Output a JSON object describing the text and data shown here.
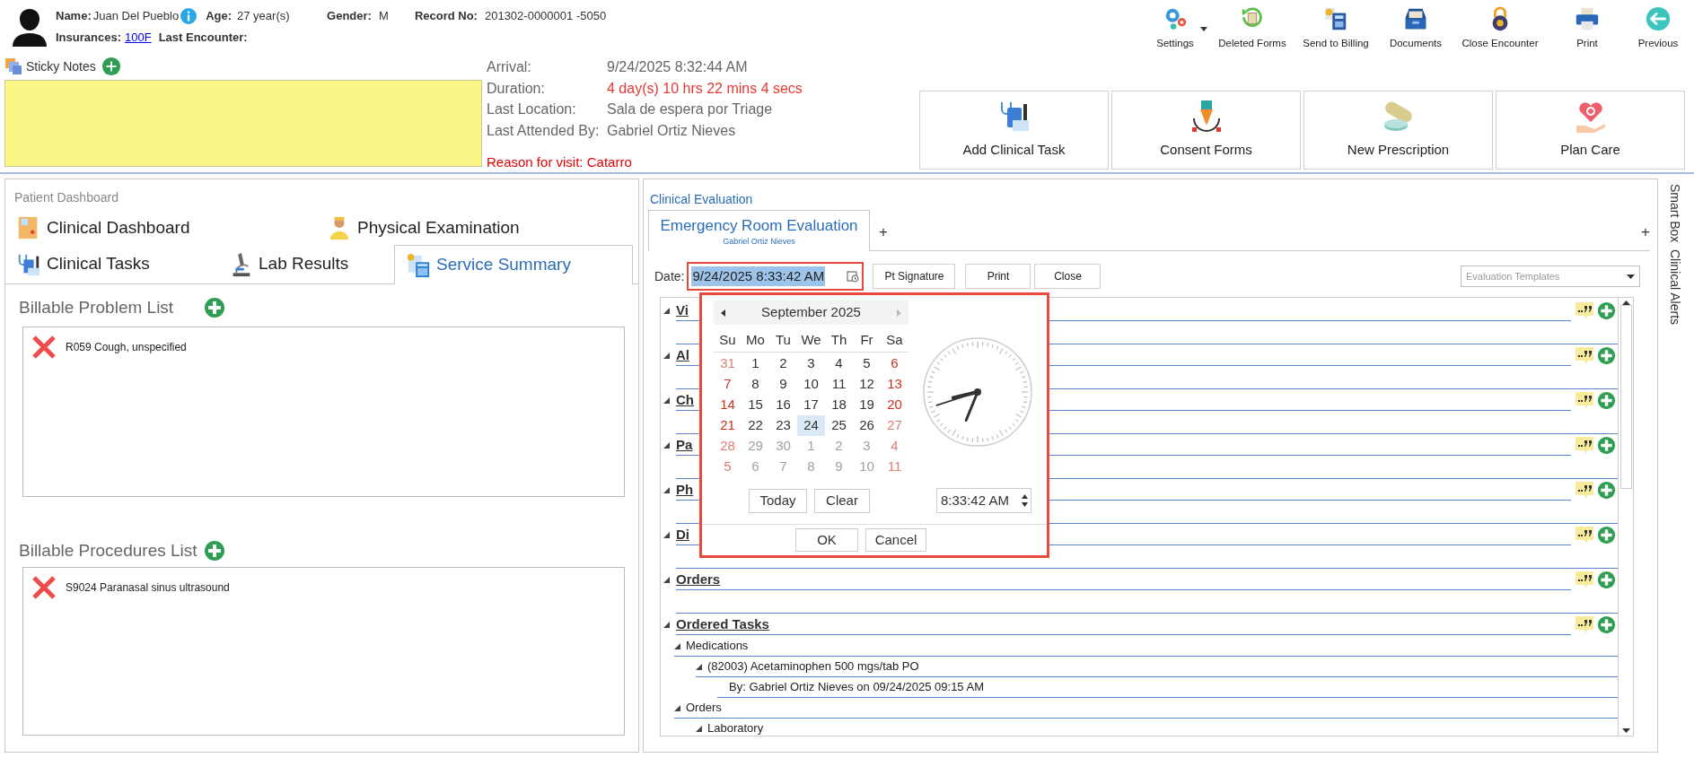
{
  "patient": {
    "name_label": "Name:",
    "name": "Juan Del Pueblo",
    "age_label": "Age:",
    "age": "27 year(s)",
    "gender_label": "Gender:",
    "gender": "M",
    "record_label": "Record No:",
    "record": "201302-0000001 -5050",
    "insurances_label": "Insurances:",
    "insurance": "100F",
    "last_encounter_label": "Last Encounter:"
  },
  "toolbar": [
    {
      "label": "Settings",
      "has_menu": true
    },
    {
      "label": "Deleted Forms",
      "has_menu": false
    },
    {
      "label": "Send to Billing",
      "has_menu": false
    },
    {
      "label": "Documents",
      "has_menu": false
    },
    {
      "label": "Close Encounter",
      "has_menu": false
    },
    {
      "label": "Print",
      "has_menu": false
    },
    {
      "label": "Previous",
      "has_menu": false
    }
  ],
  "sticky_notes": {
    "label": "Sticky Notes"
  },
  "visit": [
    {
      "label": "Arrival:",
      "value": "9/24/2025 8:32:44 AM",
      "alert": false
    },
    {
      "label": "Duration:",
      "value": "4 day(s) 10 hrs 22 mins 4 secs",
      "alert": true
    },
    {
      "label": "Last Location:",
      "value": "Sala de espera por Triage",
      "alert": false
    },
    {
      "label": "Last Attended By:",
      "value": "Gabriel Ortiz Nieves",
      "alert": false
    }
  ],
  "reason": "Reason for visit: Catarro",
  "actions": [
    "Add Clinical Task",
    "Consent Forms",
    "New Prescription",
    "Plan Care"
  ],
  "dashboard": {
    "title": "Patient Dashboard",
    "tab_rows": [
      [
        {
          "label": "Clinical Dashboard",
          "selected": false
        },
        {
          "label": "Physical Examination",
          "selected": false
        }
      ],
      [
        {
          "label": "Clinical Tasks",
          "selected": false
        },
        {
          "label": "Lab Results",
          "selected": false
        },
        {
          "label": "Service Summary",
          "selected": true
        }
      ]
    ],
    "lists": [
      {
        "title": "Billable Problem List",
        "items": [
          "R059 Cough, unspecified"
        ]
      },
      {
        "title": "Billable Procedures List",
        "items": [
          "S9024 Paranasal sinus ultrasound"
        ]
      }
    ]
  },
  "evaluation": {
    "title": "Clinical Evaluation",
    "tabs": [
      {
        "label": "Emergency Room Evaluation",
        "author": "Gabriel Ortiz Nieves",
        "selected": true
      }
    ],
    "add_tab": "+",
    "add_panel": "+",
    "date_label": "Date:",
    "date_value": "9/24/2025 8:33:42 AM",
    "buttons": [
      "Pt Signature",
      "Print",
      "Close"
    ],
    "templates": {
      "placeholder": "Evaluation Templates"
    },
    "sections": [
      {
        "label": "Vi",
        "expanded": true
      },
      {
        "label": "Al",
        "expanded": true
      },
      {
        "label": "Ch",
        "expanded": true
      },
      {
        "label": "Pa",
        "expanded": true
      },
      {
        "label": "Ph",
        "expanded": true
      },
      {
        "label": "Di",
        "expanded": true
      },
      {
        "label": "Orders",
        "expanded": true
      },
      {
        "label": "Ordered Tasks",
        "expanded": true,
        "children": [
          {
            "label": "Medications",
            "expanded": true,
            "children": [
              {
                "label": "(82003) Acetaminophen 500 mgs/tab PO",
                "expanded": true,
                "children": [
                  {
                    "label": "By: Gabriel Ortiz Nieves on 09/24/2025 09:15 AM"
                  }
                ]
              }
            ]
          },
          {
            "label": "Orders",
            "expanded": true,
            "children": [
              {
                "label": "Laboratory",
                "expanded": true
              }
            ]
          }
        ]
      }
    ]
  },
  "picker": {
    "month": "September 2025",
    "weekdays": [
      "Su",
      "Mo",
      "Tu",
      "We",
      "Th",
      "Fr",
      "Sa"
    ],
    "weeks": [
      [
        {
          "day": "31",
          "disabled": true,
          "selected": false
        },
        {
          "day": "1",
          "disabled": false,
          "selected": false
        },
        {
          "day": "2",
          "disabled": false,
          "selected": false
        },
        {
          "day": "3",
          "disabled": false,
          "selected": false
        },
        {
          "day": "4",
          "disabled": false,
          "selected": false
        },
        {
          "day": "5",
          "disabled": false,
          "selected": false
        },
        {
          "day": "6",
          "disabled": false,
          "selected": false
        }
      ],
      [
        {
          "day": "7",
          "disabled": false,
          "selected": false
        },
        {
          "day": "8",
          "disabled": false,
          "selected": false
        },
        {
          "day": "9",
          "disabled": false,
          "selected": false
        },
        {
          "day": "10",
          "disabled": false,
          "selected": false
        },
        {
          "day": "11",
          "disabled": false,
          "selected": false
        },
        {
          "day": "12",
          "disabled": false,
          "selected": false
        },
        {
          "day": "13",
          "disabled": false,
          "selected": false
        }
      ],
      [
        {
          "day": "14",
          "disabled": false,
          "selected": false
        },
        {
          "day": "15",
          "disabled": false,
          "selected": false
        },
        {
          "day": "16",
          "disabled": false,
          "selected": false
        },
        {
          "day": "17",
          "disabled": false,
          "selected": false
        },
        {
          "day": "18",
          "disabled": false,
          "selected": false
        },
        {
          "day": "19",
          "disabled": false,
          "selected": false
        },
        {
          "day": "20",
          "disabled": false,
          "selected": false
        }
      ],
      [
        {
          "day": "21",
          "disabled": false,
          "selected": false
        },
        {
          "day": "22",
          "disabled": false,
          "selected": false
        },
        {
          "day": "23",
          "disabled": false,
          "selected": false
        },
        {
          "day": "24",
          "disabled": false,
          "selected": true
        },
        {
          "day": "25",
          "disabled": false,
          "selected": false
        },
        {
          "day": "26",
          "disabled": false,
          "selected": false
        },
        {
          "day": "27",
          "disabled": true,
          "selected": false
        }
      ],
      [
        {
          "day": "28",
          "disabled": true,
          "selected": false
        },
        {
          "day": "29",
          "disabled": true,
          "selected": false
        },
        {
          "day": "30",
          "disabled": true,
          "selected": false
        },
        {
          "day": "1",
          "disabled": true,
          "selected": false
        },
        {
          "day": "2",
          "disabled": true,
          "selected": false
        },
        {
          "day": "3",
          "disabled": true,
          "selected": false
        },
        {
          "day": "4",
          "disabled": true,
          "selected": false
        }
      ],
      [
        {
          "day": "5",
          "disabled": true,
          "selected": false
        },
        {
          "day": "6",
          "disabled": true,
          "selected": false
        },
        {
          "day": "7",
          "disabled": true,
          "selected": false
        },
        {
          "day": "8",
          "disabled": true,
          "selected": false
        },
        {
          "day": "9",
          "disabled": true,
          "selected": false
        },
        {
          "day": "10",
          "disabled": true,
          "selected": false
        },
        {
          "day": "11",
          "disabled": true,
          "selected": false
        }
      ]
    ],
    "today": "Today",
    "clear": "Clear",
    "time": "8:33:42 AM",
    "ok": "OK",
    "cancel": "Cancel"
  },
  "side_tabs": [
    "Smart Box",
    "Clinical Alerts"
  ]
}
